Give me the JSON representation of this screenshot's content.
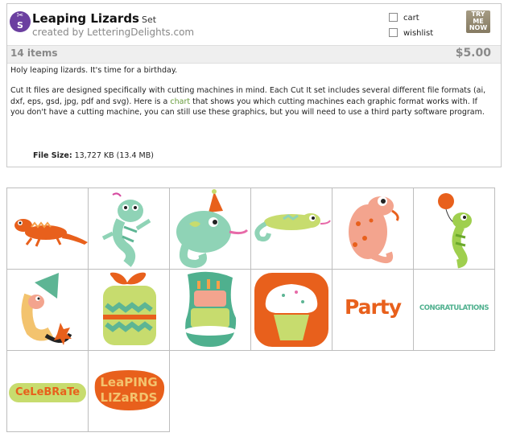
{
  "product": {
    "title": "Leaping Lizards",
    "set_label": "Set",
    "creator": "created by LetteringDelights.com",
    "item_count": "14 items",
    "price": "$5.00"
  },
  "actions": {
    "cart_label": "cart",
    "wishlist_label": "wishlist",
    "try_me_now": [
      "TRY",
      "ME",
      "NOW"
    ]
  },
  "description": {
    "intro": "Holy leaping lizards. It's time for a birthday.",
    "body_before_link": "Cut It files are designed specifically with cutting machines in mind. Each Cut It set includes several different file formats (ai, dxf, eps, gsd, jpg, pdf and svg). Here is a",
    "link_text": "chart",
    "body_after_link": "that shows you which cutting machines each graphic format works with. If you don't have a cutting machine, you can still use these graphics, but you will need to use a third party software program."
  },
  "file_size": {
    "label": "File Size:",
    "value": "13,727 KB (13.4 MB)"
  },
  "thumbnails": {
    "party_text": "Party",
    "congratulations_text": "CONGRATULATIONS",
    "celebrate_text": "CeLeBRaTe",
    "leaping_text": "LeaPING",
    "lizards_text": "LIZaRDS"
  },
  "colors": {
    "logo_purple": "#6b3fa0",
    "link_green": "#669a3a",
    "orange": "#e8601c",
    "mint": "#8fd3b6",
    "lime": "#c7dc6e",
    "salmon": "#f3a48e"
  }
}
